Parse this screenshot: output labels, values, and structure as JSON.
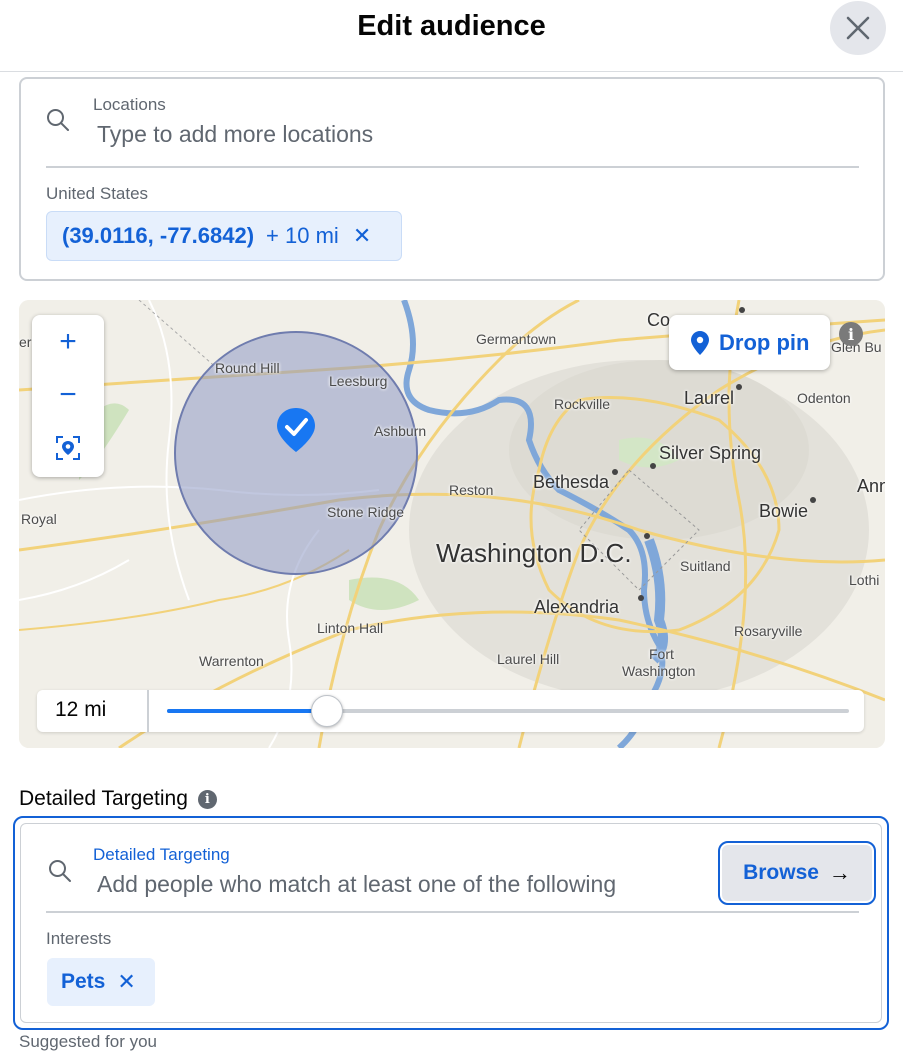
{
  "header": {
    "title": "Edit audience",
    "close_icon": "close-icon"
  },
  "locations": {
    "label": "Locations",
    "placeholder": "Type to add more locations",
    "country": "United States",
    "chip": {
      "coords": "(39.0116, -77.6842)",
      "radius": "+ 10 mi",
      "remove": "✕"
    }
  },
  "map": {
    "drop_pin_label": "Drop pin",
    "zoom_in": "+",
    "zoom_out": "−",
    "labels": {
      "germantown": "Germantown",
      "round_hill": "Round Hill",
      "leesburg": "Leesburg",
      "ashburn": "Ashburn",
      "rockville": "Rockville",
      "laurel": "Laurel",
      "odenton": "Odenton",
      "silver_spring": "Silver Spring",
      "bethesda": "Bethesda",
      "reston": "Reston",
      "stone_ridge": "Stone Ridge",
      "royal": "Royal",
      "bowie": "Bowie",
      "washington": "Washington D.C.",
      "suitland": "Suitland",
      "alexandria": "Alexandria",
      "linton_hall": "Linton Hall",
      "rosaryville": "Rosaryville",
      "warrenton": "Warrenton",
      "laurel_hill": "Laurel Hill",
      "fort_washington_1": "Fort",
      "fort_washington_2": "Washington",
      "glen_bu": "Glen Bu",
      "co": "Co",
      "ann": "Ann",
      "lothi": "Lothi",
      "er": "er"
    },
    "radius_value": "12 mi",
    "radius_slider_fraction": 0.235
  },
  "detailed_targeting": {
    "heading": "Detailed Targeting",
    "field_label": "Detailed Targeting",
    "placeholder": "Add people who match at least one of the following",
    "browse_label": "Browse",
    "browse_arrow": "→",
    "section_label": "Interests",
    "interest_chip": {
      "label": "Pets",
      "remove": "✕"
    },
    "suggested": "Suggested for you"
  },
  "colors": {
    "accent": "#1361d6",
    "chip_bg": "#e7f0fd",
    "radius_circle": "#8e99c4"
  }
}
